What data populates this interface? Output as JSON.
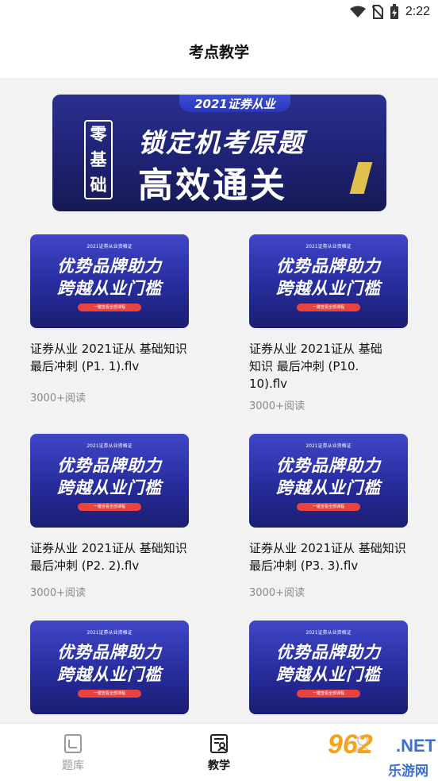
{
  "status": {
    "time": "2:22"
  },
  "header": {
    "title": "考点教学"
  },
  "hero": {
    "ribbon": "2021证券从业",
    "side": [
      "零",
      "基",
      "础"
    ],
    "line1": "锁定机考原题",
    "line2": "高效通关"
  },
  "thumb": {
    "top": "2021证券从业资格证",
    "line1": "优势品牌助力",
    "line2": "跨越从业门槛",
    "button": "一键查看全部课程"
  },
  "cards": [
    {
      "title": "证券从业 2021证从 基础知识 最后冲刺 (P1. 1).flv",
      "meta": "3000+阅读"
    },
    {
      "title": "证券从业 2021证从 基础知识 最后冲刺 (P10. 10).flv",
      "meta": "3000+阅读"
    },
    {
      "title": "证券从业 2021证从 基础知识 最后冲刺 (P2. 2).flv",
      "meta": "3000+阅读"
    },
    {
      "title": "证券从业 2021证从 基础知识 最后冲刺 (P3. 3).flv",
      "meta": "3000+阅读"
    },
    {
      "title": "",
      "meta": ""
    },
    {
      "title": "",
      "meta": ""
    }
  ],
  "tabs": [
    {
      "label": "题库",
      "icon": "question-bank-icon",
      "active": false
    },
    {
      "label": "教学",
      "icon": "teaching-icon",
      "active": true
    }
  ],
  "watermark": {
    "number": "962",
    "domain": ".NET",
    "text": "乐游网"
  },
  "colors": {
    "accent": "#2a2f8f",
    "meta": "#8a8a8a",
    "tab_inactive": "#9a9a9a"
  }
}
